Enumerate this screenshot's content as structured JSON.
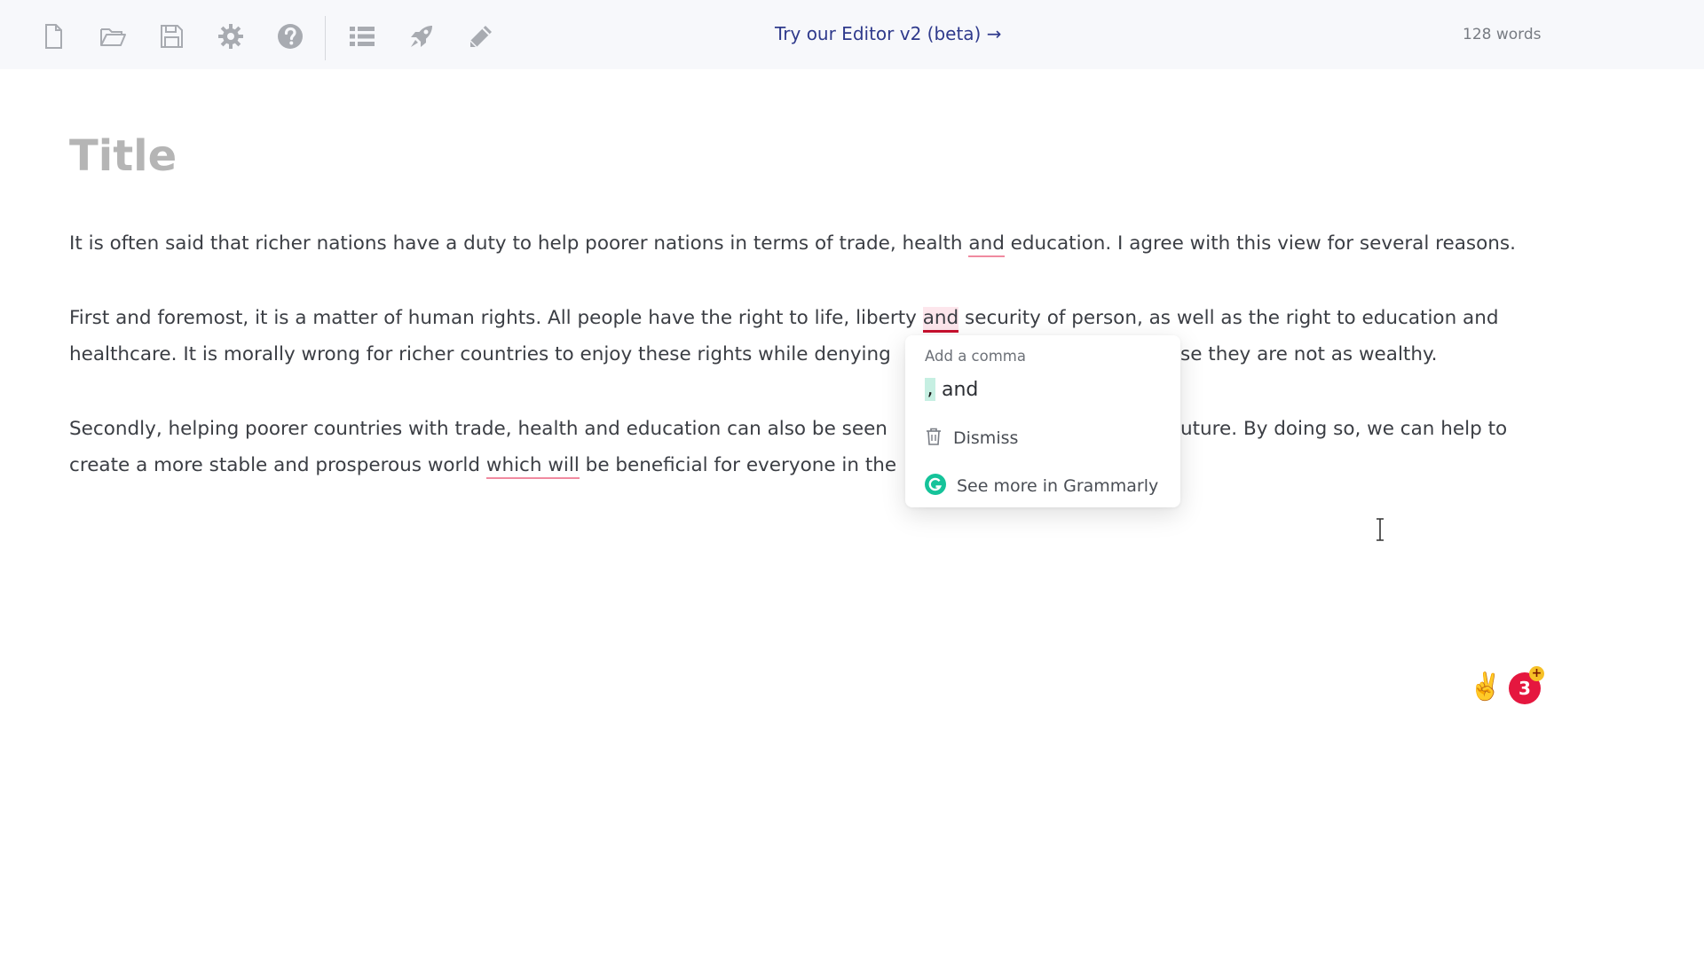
{
  "toolbar": {
    "icons": [
      "new-file-icon",
      "open-folder-icon",
      "save-icon",
      "gear-icon",
      "help-icon",
      "list-icon",
      "rocket-icon",
      "pencil-icon"
    ],
    "promo_link": "Try our Editor v2 (beta) →",
    "word_count": "128 words"
  },
  "document": {
    "title_placeholder": "Title",
    "p1": {
      "a": "It is often said that richer nations have a duty to help poorer nations in terms of trade, health ",
      "flag": "and",
      "b": " education. I agree with this view for several reasons."
    },
    "p2": {
      "l1a": "First and foremost, it is a matter of human rights. All people have the right to life, liberty ",
      "flag": "and",
      "l1b": " security of person, as well as the right to education and",
      "l2a": "healthcare. It is morally wrong for richer countries to enjoy these rights while denying ",
      "l2b": "se they are not as wealthy."
    },
    "p3": {
      "l1a": "Secondly, helping poorer countries with trade, health and education can also be seen ",
      "l1b": "uture. By doing so, we can help to",
      "l2a": "create a more stable and prosperous world ",
      "flag": "which will",
      "l2b": " be beneficial for everyone in the"
    }
  },
  "suggestion_card": {
    "heading": "Add a comma",
    "inserted": ",",
    "word": "and",
    "dismiss_label": "Dismiss",
    "more_label": "See more in Grammarly"
  },
  "assistant": {
    "emoji": "✌️",
    "issue_count": "3",
    "plus": "+"
  },
  "colors": {
    "accent_link": "#2f3a8c",
    "underline_light": "#f08aa0",
    "underline_active": "#c8102e",
    "comma_highlight": "#c6efe2",
    "grammarly_green": "#15c39a",
    "badge_red": "#e5173f"
  }
}
